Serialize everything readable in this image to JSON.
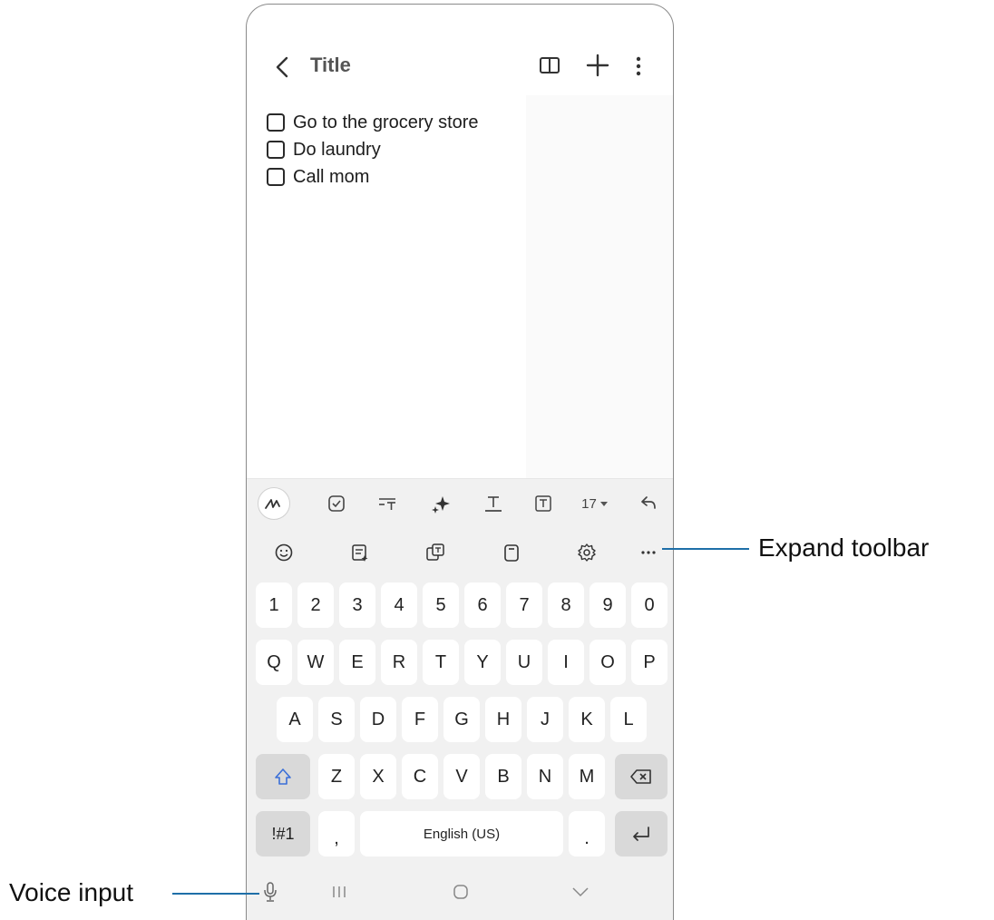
{
  "note": {
    "title_placeholder": "Title",
    "items": [
      {
        "label": "Go to the grocery store",
        "checked": false
      },
      {
        "label": "Do laundry",
        "checked": false
      },
      {
        "label": "Call mom",
        "checked": false
      }
    ]
  },
  "appbar_icons": [
    "back-icon",
    "reading-mode-icon",
    "plus-icon",
    "more-options-icon"
  ],
  "format_toolbar": {
    "icons": [
      "pen-icon",
      "checkbox-icon",
      "paragraph-style-icon",
      "ai-sparkle-icon",
      "text-color-icon",
      "text-box-icon",
      "undo-icon"
    ],
    "font_size": "17"
  },
  "keyboard_toolbar": {
    "icons": [
      "emoji-icon",
      "text-edit-icon",
      "translate-icon",
      "clipboard-icon",
      "settings-icon",
      "expand-toolbar-icon"
    ]
  },
  "keyboard": {
    "number_row": [
      "1",
      "2",
      "3",
      "4",
      "5",
      "6",
      "7",
      "8",
      "9",
      "0"
    ],
    "row1": [
      "Q",
      "W",
      "E",
      "R",
      "T",
      "Y",
      "U",
      "I",
      "O",
      "P"
    ],
    "row2": [
      "A",
      "S",
      "D",
      "F",
      "G",
      "H",
      "J",
      "K",
      "L"
    ],
    "row3": [
      "Z",
      "X",
      "C",
      "V",
      "B",
      "N",
      "M"
    ],
    "symbols_label": "!#1",
    "comma_label": ",",
    "space_label": "English (US)",
    "period_label": ".",
    "accent_color": "#3a6fd8"
  },
  "callouts": {
    "expand_toolbar": "Expand toolbar",
    "voice_input": "Voice input",
    "leader_color": "#1e6fa8"
  }
}
